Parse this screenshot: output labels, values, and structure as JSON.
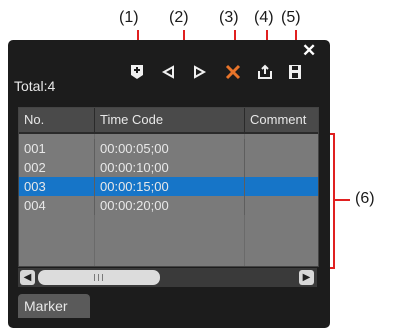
{
  "callouts": [
    "(1)",
    "(2)",
    "(3)",
    "(4)",
    "(5)",
    "(6)"
  ],
  "panel": {
    "total_label": "Total:4",
    "close_icon": "close-icon"
  },
  "toolbar": {
    "icons": [
      "add-marker-icon",
      "previous-marker-icon",
      "next-marker-icon",
      "delete-marker-icon",
      "export-markers-icon",
      "save-markers-icon"
    ]
  },
  "table": {
    "columns": [
      "No.",
      "Time Code",
      "Comment"
    ],
    "rows": [
      {
        "no": "001",
        "time_code": "00:00:05;00",
        "comment": ""
      },
      {
        "no": "002",
        "time_code": "00:00:10;00",
        "comment": ""
      },
      {
        "no": "003",
        "time_code": "00:00:15;00",
        "comment": ""
      },
      {
        "no": "004",
        "time_code": "00:00:20;00",
        "comment": ""
      }
    ],
    "selected_row": "003"
  },
  "tab": {
    "label": "Marker"
  },
  "colors": {
    "panel_bg": "#1c1c1c",
    "selection": "#1675c8",
    "callout_line": "#e02020",
    "delete_icon": "#e8742a"
  }
}
